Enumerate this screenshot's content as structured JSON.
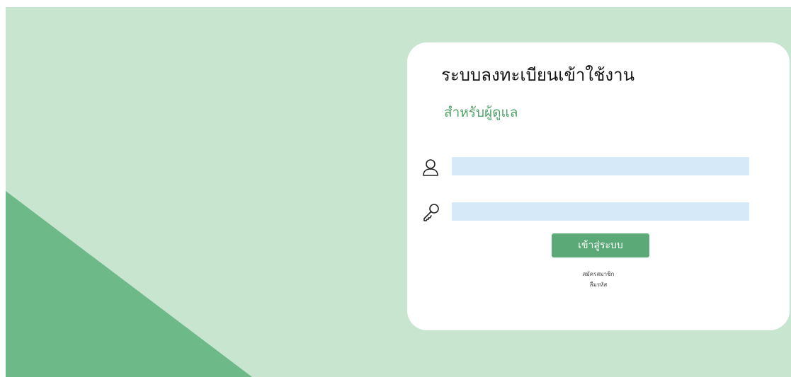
{
  "login": {
    "title": "ระบบลงทะเบียนเข้าใช้งาน",
    "subtitle": "สำหรับผู้ดูแล",
    "username": {
      "value": "",
      "placeholder": ""
    },
    "password": {
      "value": "",
      "placeholder": ""
    },
    "submit_label": "เข้าสู่ระบบ",
    "register_link": "สมัครสมาชิก",
    "forgot_link": "ลืมรหัส"
  },
  "colors": {
    "background": "#c8e5cf",
    "triangle": "#6db988",
    "accent": "#5aa977",
    "input_fill": "#d6e9f8"
  },
  "icons": [
    "user-icon",
    "key-icon"
  ]
}
